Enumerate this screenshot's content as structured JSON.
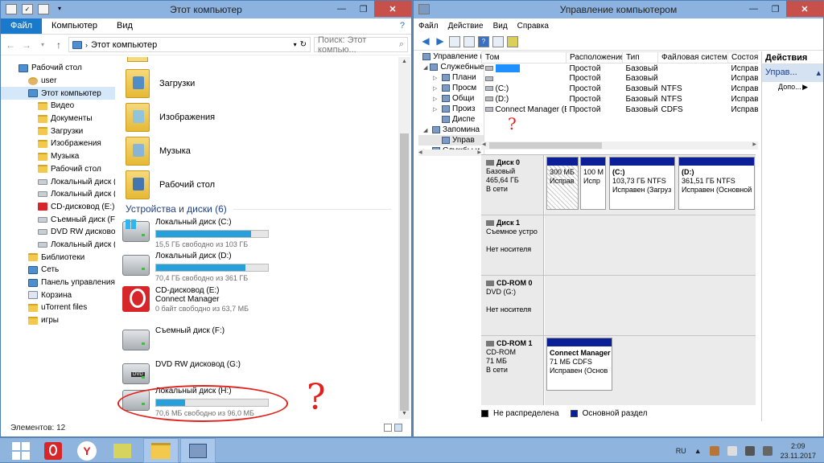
{
  "explorer": {
    "title": "Этот компьютер",
    "tabs": [
      "Файл",
      "Компьютер",
      "Вид"
    ],
    "address": "Этот компьютер",
    "search_placeholder": "Поиск: Этот компью...",
    "nav": [
      {
        "label": "Рабочий стол",
        "icon": "desktop-icon",
        "level": 0
      },
      {
        "label": "user",
        "icon": "user-icon",
        "level": 1
      },
      {
        "label": "Этот компьютер",
        "icon": "computer-icon",
        "level": 1,
        "selected": true
      },
      {
        "label": "Видео",
        "icon": "folder-icon",
        "level": 2
      },
      {
        "label": "Документы",
        "icon": "folder-icon",
        "level": 2
      },
      {
        "label": "Загрузки",
        "icon": "folder-icon",
        "level": 2
      },
      {
        "label": "Изображения",
        "icon": "folder-icon",
        "level": 2
      },
      {
        "label": "Музыка",
        "icon": "folder-icon",
        "level": 2
      },
      {
        "label": "Рабочий стол",
        "icon": "folder-icon",
        "level": 2
      },
      {
        "label": "Локальный диск (C:)",
        "icon": "drive-icon",
        "level": 2
      },
      {
        "label": "Локальный диск (D:)",
        "icon": "drive-icon",
        "level": 2
      },
      {
        "label": "CD-дисковод (E:) Cor",
        "icon": "cd-icon",
        "level": 2
      },
      {
        "label": "Съемный диск (F:)",
        "icon": "drive-icon",
        "level": 2
      },
      {
        "label": "DVD RW дисковод (G",
        "icon": "dvd-icon",
        "level": 2
      },
      {
        "label": "Локальный диск (H:)",
        "icon": "drive-icon",
        "level": 2
      },
      {
        "label": "Библиотеки",
        "icon": "library-icon",
        "level": 1
      },
      {
        "label": "Сеть",
        "icon": "network-icon",
        "level": 1
      },
      {
        "label": "Панель управления",
        "icon": "control-panel-icon",
        "level": 1
      },
      {
        "label": "Корзина",
        "icon": "recycle-bin-icon",
        "level": 1
      },
      {
        "label": "uTorrent files",
        "icon": "folder-icon",
        "level": 1
      },
      {
        "label": "игры",
        "icon": "folder-icon",
        "level": 1
      }
    ],
    "folders": [
      "Загрузки",
      "Изображения",
      "Музыка",
      "Рабочий стол"
    ],
    "section_title": "Устройства и диски (6)",
    "devices": [
      {
        "name": "Локальный диск (C:)",
        "free": "15,5 ГБ свободно из 103 ГБ",
        "used_fraction": 0.85,
        "icon": "windows-drive-icon"
      },
      {
        "name": "Локальный диск (D:)",
        "free": "70,4 ГБ свободно из 361 ГБ",
        "used_fraction": 0.8,
        "icon": "hdd-icon"
      },
      {
        "name": "CD-дисковод (E:) Connect Manager",
        "free": "0 байт свободно из 63,7 МБ",
        "icon": "cd-drive-icon"
      },
      {
        "name": "Съемный диск (F:)",
        "free": "",
        "icon": "removable-drive-icon"
      },
      {
        "name": "DVD RW дисковод (G:)",
        "free": "",
        "icon": "dvd-drive-icon"
      },
      {
        "name": "Локальный диск (H:)",
        "free": "70,6 МБ свободно из 96,0 МБ",
        "used_fraction": 0.26,
        "icon": "hdd-icon"
      }
    ],
    "status": "Элементов: 12",
    "annotation_mark": "?"
  },
  "mmc": {
    "title": "Управление компьютером",
    "menu": [
      "Файл",
      "Действие",
      "Вид",
      "Справка"
    ],
    "tree": [
      {
        "label": "Управление к",
        "exp": ""
      },
      {
        "label": "Служебные",
        "exp": "◢"
      },
      {
        "label": "Плани",
        "exp": "▷"
      },
      {
        "label": "Просм",
        "exp": "▷"
      },
      {
        "label": "Общи",
        "exp": "▷"
      },
      {
        "label": "Произ",
        "exp": "▷"
      },
      {
        "label": "Диспе",
        "exp": ""
      },
      {
        "label": "Запомина",
        "exp": "◢"
      },
      {
        "label": "Управ",
        "exp": "",
        "selected": true
      },
      {
        "label": "Службы и",
        "exp": "▷"
      }
    ],
    "columns": [
      "Том",
      "Расположение",
      "Тип",
      "Файловая система",
      "Состоян"
    ],
    "rows": [
      {
        "name": "",
        "redacted": true,
        "loc": "Простой",
        "type": "Базовый",
        "fs": "",
        "state": "Исправ"
      },
      {
        "name": "",
        "redacted": false,
        "loc": "Простой",
        "type": "Базовый",
        "fs": "",
        "state": "Исправ"
      },
      {
        "name": "(C:)",
        "loc": "Простой",
        "type": "Базовый",
        "fs": "NTFS",
        "state": "Исправ"
      },
      {
        "name": "(D:)",
        "loc": "Простой",
        "type": "Базовый",
        "fs": "NTFS",
        "state": "Исправ"
      },
      {
        "name": "Connect Manager (E:)",
        "loc": "Простой",
        "type": "Базовый",
        "fs": "CDFS",
        "state": "Исправ"
      }
    ],
    "actions_header": "Действия",
    "actions_sub": "Управ...",
    "actions_more": "Допо...",
    "disks": [
      {
        "name": "Диск 0",
        "lines": [
          "Базовый",
          "465,64 ГБ",
          "В сети"
        ],
        "parts": [
          {
            "lines": [
              "300 МБ",
              "Исправ"
            ],
            "hatch": true
          },
          {
            "lines": [
              "100 М",
              "Испр"
            ]
          },
          {
            "lines": [
              "(C:)",
              "103,73 ГБ NTFS",
              "Исправен (Загруз"
            ]
          },
          {
            "lines": [
              "(D:)",
              "361,51 ГБ NTFS",
              "Исправен (Основной"
            ]
          }
        ]
      },
      {
        "name": "Диск 1",
        "lines": [
          "Съемное устро",
          "",
          "Нет носителя"
        ],
        "parts": []
      },
      {
        "name": "CD-ROM 0",
        "lines": [
          "DVD (G:)",
          "",
          "Нет носителя"
        ],
        "parts": []
      },
      {
        "name": "CD-ROM 1",
        "lines": [
          "CD-ROM",
          "71 МБ",
          "В сети"
        ],
        "parts": [
          {
            "lines": [
              "Connect Manager",
              "71 МБ CDFS",
              "Исправен (Основ"
            ],
            "bold_first": true
          }
        ]
      }
    ],
    "legend": [
      "Не распределена",
      "Основной раздел"
    ],
    "annotation_mark": "?"
  },
  "taskbar": {
    "lang": "RU",
    "time": "2:09",
    "date": "23.11.2017"
  },
  "colors": {
    "accent": "#1979ca",
    "bar_fill": "#26a0da",
    "partition_header": "#0b1f96",
    "annotation": "#e0221d"
  }
}
